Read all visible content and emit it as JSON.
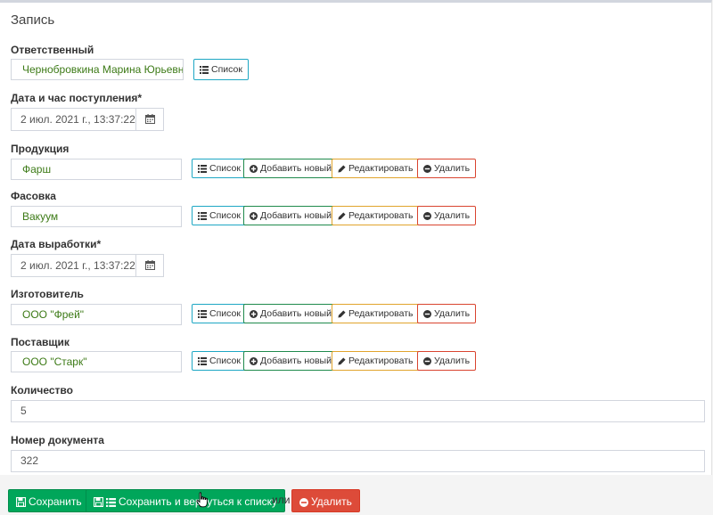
{
  "panel": {
    "title": "Запись"
  },
  "fields": {
    "responsible": {
      "label": "Ответственный",
      "value": "Чернобровкина Марина Юрьевна",
      "list_label": "Список"
    },
    "received": {
      "label": "Дата и час поступления*",
      "value": "2 июл. 2021 г., 13:37:22"
    },
    "product": {
      "label": "Продукция",
      "value": "Фарш"
    },
    "packing": {
      "label": "Фасовка",
      "value": "Вакуум"
    },
    "production_date": {
      "label": "Дата выработки*",
      "value": "2 июл. 2021 г., 13:37:22"
    },
    "manufacturer": {
      "label": "Изготовитель",
      "value": "ООО \"Фрей\""
    },
    "supplier": {
      "label": "Поставщик",
      "value": "ООО \"Старк\""
    },
    "quantity": {
      "label": "Количество",
      "value": "5"
    },
    "doc_number": {
      "label": "Номер документа",
      "value": "322"
    }
  },
  "buttons": {
    "list": "Список",
    "add_new": "Добавить новый",
    "edit": "Редактировать",
    "delete": "Удалить"
  },
  "footer": {
    "save": "Сохранить",
    "save_return": "Сохранить и вернуться к списку",
    "or": "или",
    "delete": "Удалить"
  },
  "colors": {
    "info": "#1ea7c4",
    "success": "#00a65a",
    "warning": "#e1a42c",
    "danger": "#dd4b39",
    "value_text": "#3c7a16"
  },
  "icons": {
    "list": "list-icon",
    "add": "plus-circle-icon",
    "edit": "pencil-icon",
    "delete": "minus-circle-icon",
    "calendar": "calendar-icon",
    "save": "floppy-icon"
  }
}
